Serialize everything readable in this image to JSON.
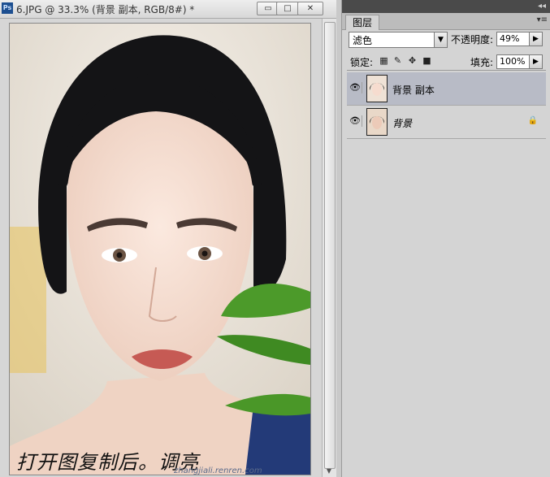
{
  "document": {
    "title": "6.JPG @ 33.3% (背景 副本, RGB/8#) *",
    "app_icon": "Ps",
    "window_buttons": {
      "minimize": "▭",
      "maximize": "□",
      "close": "✕"
    },
    "caption": "打开图复制后。调亮",
    "watermark": "zhangjiali.renren.com"
  },
  "layers_panel": {
    "tab_label": "图层",
    "blend_mode": "滤色",
    "opacity_label": "不透明度:",
    "opacity_value": "49%",
    "lock_label": "锁定:",
    "fill_label": "填充:",
    "fill_value": "100%",
    "layers": [
      {
        "name": "背景 副本",
        "visible": true,
        "selected": true,
        "locked": false
      },
      {
        "name": "背景",
        "visible": true,
        "selected": false,
        "locked": true
      }
    ]
  },
  "icons": [
    "photoshop-icon",
    "minimize-icon",
    "maximize-icon",
    "close-icon",
    "eye-icon",
    "lock-transparent-icon",
    "lock-brush-icon",
    "lock-move-icon",
    "lock-all-icon",
    "layer-lock-icon",
    "dropdown-arrow-icon",
    "right-arrow-icon"
  ]
}
